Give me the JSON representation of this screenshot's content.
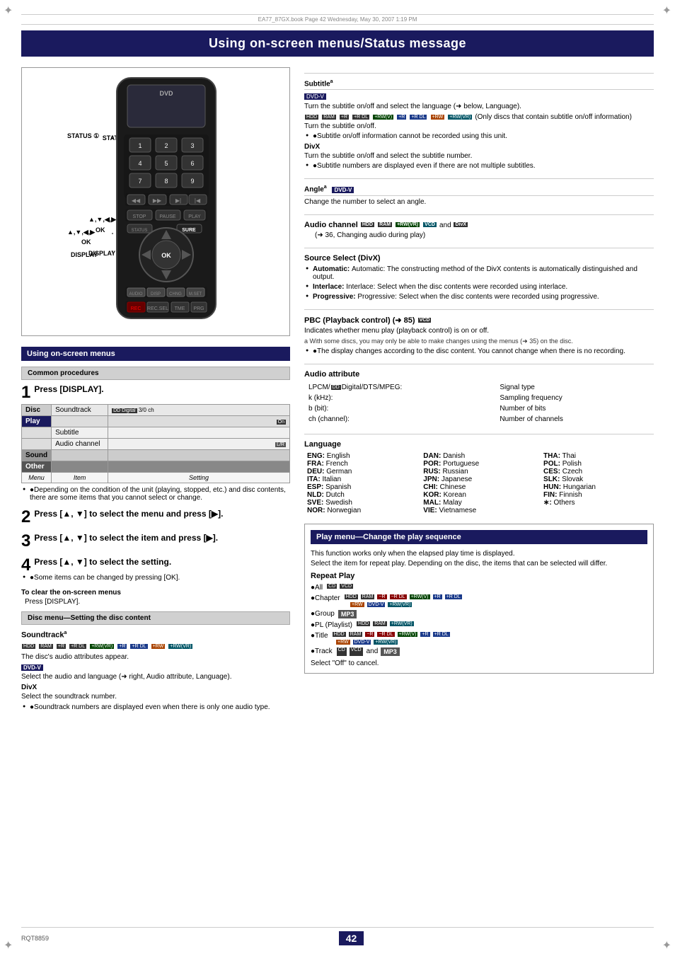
{
  "page": {
    "title": "Using on-screen menus/Status message",
    "meta_line": "EA77_87GX.book   Page 42   Wednesday, May 30, 2007   1:19 PM",
    "page_number": "42",
    "page_code": "RQT8859"
  },
  "left": {
    "section_title": "Using on-screen menus",
    "common_procedures_label": "Common procedures",
    "step1": {
      "number": "1",
      "text": "Press [DISPLAY].",
      "menu_table": {
        "rows": [
          {
            "col1": "Disc",
            "col2": "Soundtrack",
            "col3": "DD Digital  3/0 ch",
            "class": "disc"
          },
          {
            "col1": "Play",
            "col2": "",
            "col3": "On",
            "class": "play"
          },
          {
            "col1": "",
            "col2": "Subtitle",
            "col3": "",
            "class": "subtitle"
          },
          {
            "col1": "",
            "col2": "Audio channel",
            "col3": "L/R",
            "class": "audio"
          },
          {
            "col1": "Sound",
            "col2": "",
            "col3": "",
            "class": "sound"
          },
          {
            "col1": "Other",
            "col2": "",
            "col3": "",
            "class": "other"
          }
        ],
        "footer": {
          "menu": "Menu",
          "item": "Item",
          "setting": "Setting"
        }
      }
    },
    "step1_note": "●Depending on the condition of the unit (playing, stopped, etc.) and disc contents, there are some items that you cannot select or change.",
    "step2": {
      "number": "2",
      "text": "Press [▲, ▼] to select the menu and press [▶]."
    },
    "step3": {
      "number": "3",
      "text": "Press [▲, ▼] to select the item and press [▶]."
    },
    "step4": {
      "number": "4",
      "text": "Press [▲, ▼] to select the setting.",
      "note": "●Some items can be changed by pressing [OK]."
    },
    "clear_label": "To clear the on-screen menus",
    "clear_text": "Press [DISPLAY].",
    "disc_menu_label": "Disc menu—Setting the disc content",
    "soundtrack_label": "Soundtrack",
    "soundtrack_tags": [
      "HDD",
      "RAM",
      "+R",
      "+R DL",
      "+RW(VR)",
      "+R",
      "+R DL",
      "+RW",
      "+RW(VR)"
    ],
    "soundtrack_text1": "The disc's audio attributes appear.",
    "dvdv_label": "DVD-V",
    "dvdv_text": "Select the audio and language (➜ right, Audio attribute, Language).",
    "divx_label": "DivX",
    "divx_text": "Select the soundtrack number.",
    "soundtrack_note": "●Soundtrack numbers are displayed even when there is only one audio type."
  },
  "right": {
    "subtitle_label": "Subtitle",
    "subtitle_sup": "a",
    "subtitle_dvdv": "DVD-V",
    "subtitle_text1": "Turn the subtitle on/off and select the language (➜ below, Language).",
    "subtitle_tags": [
      "HDD",
      "RAM",
      "+R",
      "+R DL",
      "+RW(V)",
      "+R",
      "+R DL",
      "+RW",
      "+RW(VR)"
    ],
    "subtitle_text2": "(Only discs that contain subtitle on/off information)",
    "subtitle_text3": "Turn the subtitle on/off.",
    "subtitle_note": "●Subtitle on/off information cannot be recorded using this unit.",
    "divx_sub_label": "DivX",
    "divx_sub_text": "Turn the subtitle on/off and select the subtitle number.",
    "divx_sub_note": "●Subtitle numbers are displayed even if there are not multiple subtitles.",
    "angle_label": "Angle",
    "angle_sup": "a",
    "angle_dvdv": "DVD-V",
    "angle_text": "Change the number to select an angle.",
    "audio_channel_label": "Audio channel",
    "audio_channel_tags": [
      "HDD",
      "RAM",
      "+RW(VR)",
      "VCD",
      "and",
      "DivX"
    ],
    "audio_channel_text": "(➜ 36, Changing audio during play)",
    "source_select_label": "Source Select (DivX)",
    "source_automatic": "Automatic: The constructing method of the DivX contents is automatically distinguished and output.",
    "source_interlace": "Interlace: Select when the disc contents were recorded using interlace.",
    "source_progressive": "Progressive: Select when the disc contents were recorded using progressive.",
    "pbc_label": "PBC (Playback control) (➜ 85)",
    "pbc_vcd": "VCD",
    "pbc_text": "Indicates whether menu play (playback control) is on or off.",
    "note_a": "a With some discs, you may only be able to make changes using the menus (➜ 35) on the disc.",
    "display_note": "●The display changes according to the disc content. You cannot change when there is no recording.",
    "audio_attr_label": "Audio attribute",
    "audio_attr_rows": [
      {
        "left": "LPCM/DD Digital/DTS/MPEG:",
        "right": "Signal type"
      },
      {
        "left": "k (kHz):",
        "right": "Sampling frequency"
      },
      {
        "left": "b (bit):",
        "right": "Number of bits"
      },
      {
        "left": "ch (channel):",
        "right": "Number of channels"
      }
    ],
    "language_label": "Language",
    "language_cols": [
      [
        {
          "code": "ENG:",
          "lang": "English"
        },
        {
          "code": "FRA:",
          "lang": "French"
        },
        {
          "code": "DEU:",
          "lang": "German"
        },
        {
          "code": "ITA:",
          "lang": "Italian"
        },
        {
          "code": "ESP:",
          "lang": "Spanish"
        },
        {
          "code": "NLD:",
          "lang": "Dutch"
        },
        {
          "code": "SVE:",
          "lang": "Swedish"
        },
        {
          "code": "NOR:",
          "lang": "Norwegian"
        }
      ],
      [
        {
          "code": "DAN:",
          "lang": "Danish"
        },
        {
          "code": "POR:",
          "lang": "Portuguese"
        },
        {
          "code": "RUS:",
          "lang": "Russian"
        },
        {
          "code": "JPN:",
          "lang": "Japanese"
        },
        {
          "code": "CHI:",
          "lang": "Chinese"
        },
        {
          "code": "KOR:",
          "lang": "Korean"
        },
        {
          "code": "MAL:",
          "lang": "Malay"
        },
        {
          "code": "VIE:",
          "lang": "Vietnamese"
        }
      ],
      [
        {
          "code": "THA:",
          "lang": "Thai"
        },
        {
          "code": "POL:",
          "lang": "Polish"
        },
        {
          "code": "CES:",
          "lang": "Czech"
        },
        {
          "code": "SLK:",
          "lang": "Slovak"
        },
        {
          "code": "HUN:",
          "lang": "Hungarian"
        },
        {
          "code": "FIN:",
          "lang": "Finnish"
        },
        {
          "code": "∗:",
          "lang": "Others"
        }
      ]
    ],
    "play_menu_label": "Play menu—Change the play sequence",
    "play_menu_text1": "This function works only when the elapsed play time is displayed.",
    "play_menu_text2": "Select the item for repeat play. Depending on the disc, the items that can be selected will differ.",
    "repeat_play_label": "Repeat Play",
    "repeat_items": [
      {
        "label": "●All",
        "tags": [
          "CD",
          "VCD"
        ]
      },
      {
        "label": "●Chapter",
        "tags": [
          "HDD",
          "RAM",
          "−R",
          "−R DL",
          "+RW(V)",
          "+R",
          "+R DL"
        ],
        "tags2": [
          "+RW",
          "DVD-V",
          "+RW(VR)"
        ]
      },
      {
        "label": "●Group",
        "tags": [
          "MP3"
        ]
      },
      {
        "label": "●PL (Playlist)",
        "tags": [
          "HDD",
          "RAM",
          "+RW(VR)"
        ]
      },
      {
        "label": "●Title",
        "tags": [
          "HDD",
          "RAM",
          "−R",
          "−R DL",
          "+RW(V)",
          "+R",
          "+R DL"
        ],
        "tags2": [
          "+RW",
          "DVD-V",
          "+RW(VR)"
        ]
      },
      {
        "label": "●Track",
        "tags": [
          "CD",
          "VCD",
          "and",
          "MP3"
        ]
      }
    ],
    "select_off_text": "Select \"Off\" to cancel."
  },
  "labels": {
    "status": "STATUS ①",
    "nav": "▲,▼,◀,▶",
    "ok": "OK",
    "display": "DISPLAY"
  }
}
